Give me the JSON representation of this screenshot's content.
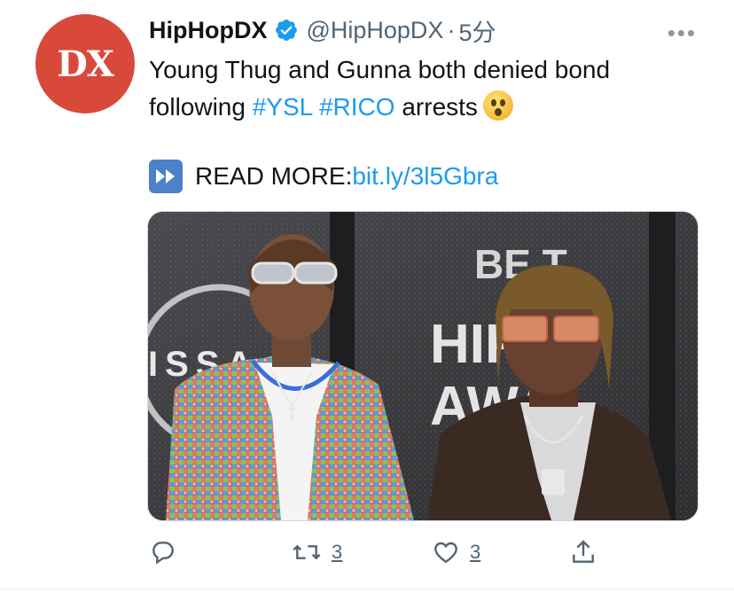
{
  "account": {
    "avatar_text": "DX",
    "name": "HipHopDX",
    "handle": "@HipHopDX",
    "separator": "·",
    "time": "5分",
    "more": "•••"
  },
  "tweet": {
    "text_line1": "Young Thug and Gunna both denied bond",
    "text_prefix2": "following ",
    "hashtag1": "#YSL",
    "hashtag2": "#RICO",
    "text_suffix2": " arrests",
    "emoji": "hushed-face",
    "readmore_label": "READ MORE: ",
    "link": "bit.ly/3l5Gbra"
  },
  "media": {
    "logo_text": "ISSA",
    "bet_text": "BE T",
    "hip_text": "HIP",
    "awa_text": "AWA"
  },
  "actions": {
    "retweet_count": "3",
    "like_count": "3"
  },
  "colors": {
    "accent": "#1d9bf0",
    "avatar_bg": "#d9493a",
    "secondary_text": "#536471"
  }
}
